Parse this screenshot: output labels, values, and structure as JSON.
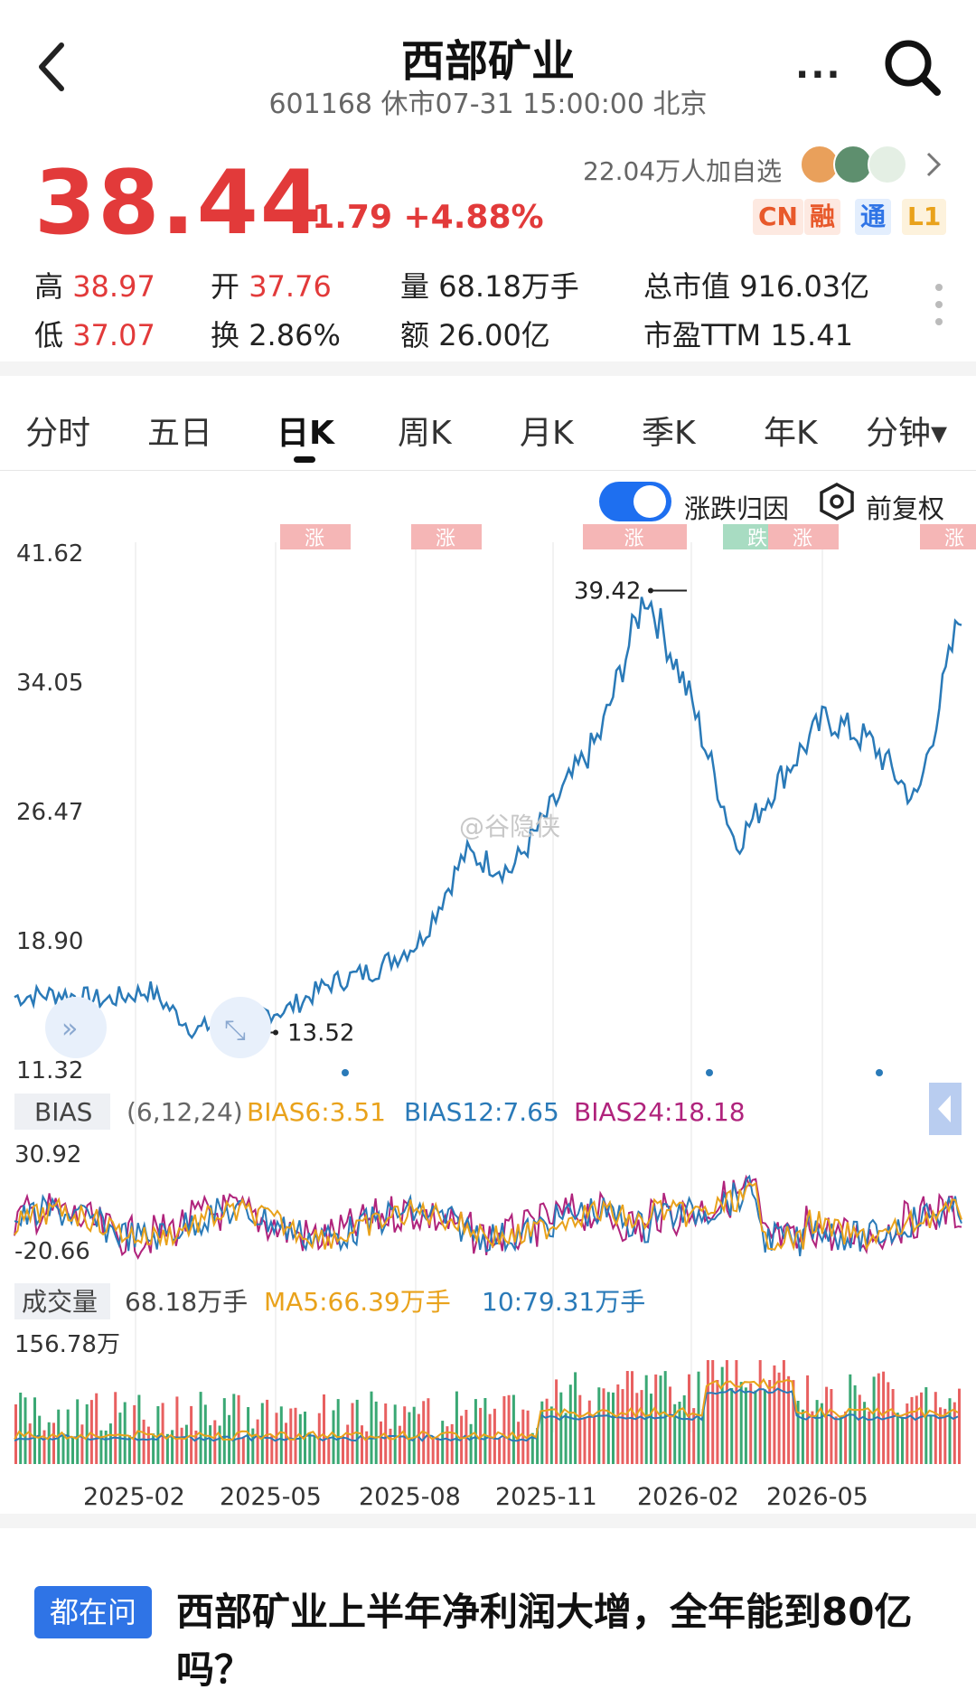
{
  "header": {
    "title": "西部矿业",
    "subtitle": "601168 休市07-31 15:00:00 北京"
  },
  "quote": {
    "price": "38.44",
    "change": "+1.79 +4.88%",
    "followers": "22.04万人加自选",
    "badges": [
      {
        "label": "CN",
        "color": "#e8592b",
        "bg": "#fde9e1"
      },
      {
        "label": "融",
        "color": "#e8592b",
        "bg": "#fde9e1"
      },
      {
        "label": "通",
        "color": "#2f74e6",
        "bg": "#e3eefd"
      },
      {
        "label": "L1",
        "color": "#e9a21b",
        "bg": "#fdf2dc"
      }
    ],
    "stats": {
      "high_label": "高",
      "high": "38.97",
      "low_label": "低",
      "low": "37.07",
      "open_label": "开",
      "open": "37.76",
      "turnover_label": "换",
      "turnover": "2.86%",
      "volume_label": "量",
      "volume": "68.18万手",
      "amount_label": "额",
      "amount": "26.00亿",
      "mktcap_label": "总市值",
      "mktcap": "916.03亿",
      "pe_label": "市盈TTM",
      "pe": "15.41"
    }
  },
  "tabs": [
    "分时",
    "五日",
    "日K",
    "周K",
    "月K",
    "季K",
    "年K",
    "分钟▾"
  ],
  "active_tab": "日K",
  "chart_controls": {
    "toggle_label": "涨跌归因",
    "adjust_label": "前复权"
  },
  "watermark": "@谷隐侠",
  "colors": {
    "up": "#e23a3a",
    "down": "#2fa36b",
    "line": "#2a7ab8",
    "ma5": "#e9a21b",
    "ma10": "#2a7ab8",
    "ma24": "#b0237c",
    "accent": "#1e6ff0"
  },
  "chart_data": {
    "type": "line",
    "price": {
      "y_ticks": [
        "41.62",
        "34.05",
        "26.47",
        "18.90",
        "11.32"
      ],
      "ylim": [
        11.32,
        41.62
      ],
      "high_label": "39.42",
      "low_label": "13.52",
      "event_tags": [
        {
          "label": "涨",
          "kind": "up"
        },
        {
          "label": "涨",
          "kind": "up"
        },
        {
          "label": "涨",
          "kind": "up"
        },
        {
          "label": "跌",
          "kind": "down"
        },
        {
          "label": "涨",
          "kind": "up"
        },
        {
          "label": "涨",
          "kind": "up"
        }
      ],
      "series": [
        {
          "date": "2025-01",
          "value": 15.6
        },
        {
          "date": "2025-02",
          "value": 15.8
        },
        {
          "date": "2025-03",
          "value": 15.4
        },
        {
          "date": "2025-04",
          "value": 16.0
        },
        {
          "date": "2025-04b",
          "value": 13.6
        },
        {
          "date": "2025-05",
          "value": 14.6
        },
        {
          "date": "2025-06",
          "value": 14.8
        },
        {
          "date": "2025-07",
          "value": 16.4
        },
        {
          "date": "2025-08",
          "value": 17.2
        },
        {
          "date": "2025-09",
          "value": 18.9
        },
        {
          "date": "2025-10",
          "value": 24.0
        },
        {
          "date": "2025-11",
          "value": 23.0
        },
        {
          "date": "2025-12",
          "value": 27.0
        },
        {
          "date": "2026-01",
          "value": 31.0
        },
        {
          "date": "2026-01b",
          "value": 39.4
        },
        {
          "date": "2026-02",
          "value": 33.0
        },
        {
          "date": "2026-03",
          "value": 24.5
        },
        {
          "date": "2026-04",
          "value": 28.5
        },
        {
          "date": "2026-05",
          "value": 32.0
        },
        {
          "date": "2026-06",
          "value": 30.5
        },
        {
          "date": "2026-06b",
          "value": 27.0
        },
        {
          "date": "2026-07",
          "value": 38.4
        }
      ]
    },
    "bias": {
      "label": "BIAS",
      "params": "(6,12,24)",
      "bias6": "BIAS6:3.51",
      "bias12": "BIAS12:7.65",
      "bias24": "BIAS24:18.18",
      "y_top": "30.92",
      "y_bottom": "-20.66"
    },
    "volume": {
      "label": "成交量",
      "current": "68.18万手",
      "ma5": "MA5:66.39万手",
      "ma10": "10:79.31万手",
      "y_top": "156.78万"
    },
    "x_ticks": [
      "2025-02",
      "2025-05",
      "2025-08",
      "2025-11",
      "2026-02",
      "2026-05"
    ]
  },
  "question": {
    "badge": "都在问",
    "title": "西部矿业上半年净利润大增，全年能到80亿吗？"
  }
}
